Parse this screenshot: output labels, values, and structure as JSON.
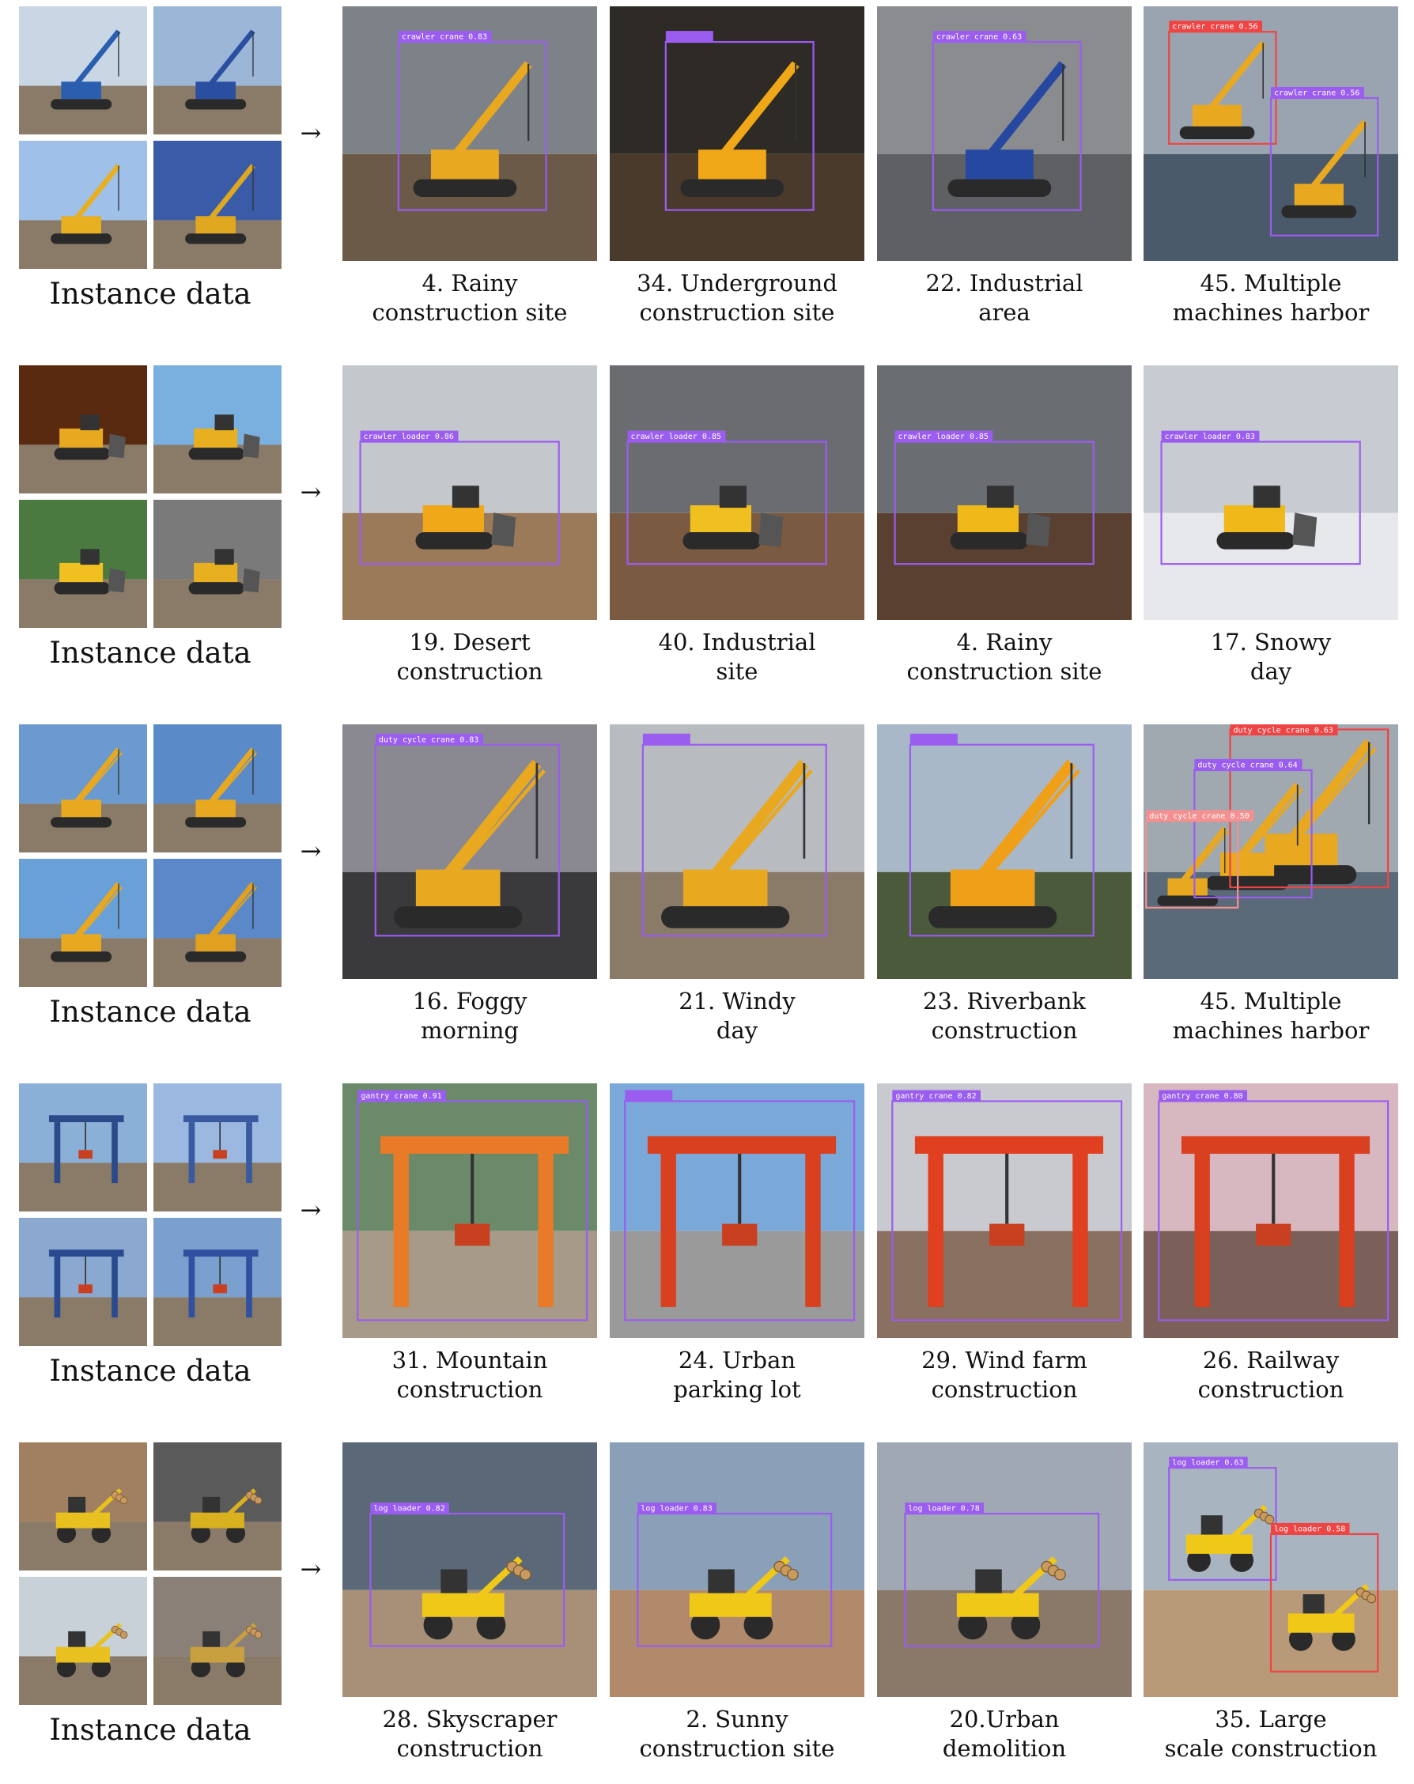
{
  "rows": [
    {
      "instance_caption": "Instance data",
      "arrow": "→",
      "machine": "crawler-crane",
      "instance_colors": [
        "#2a5fb0",
        "#2a4fa0",
        "#e8b020",
        "#e0a820"
      ],
      "instance_skies": [
        "#c9d6e4",
        "#9cb6d8",
        "#9fc0e8",
        "#3a5ca8"
      ],
      "scenes": [
        {
          "line1": "4.  Rainy",
          "line2": "construction site",
          "sky": "#7d8288",
          "ground": "#6b5a48",
          "machine_color": "#e8a820",
          "detections": [
            {
              "label": "crawler crane 0.83",
              "color": "#9b5cf0"
            }
          ]
        },
        {
          "line1": "34.  Underground",
          "line2": "construction site",
          "sky": "#2e2a26",
          "ground": "#4a3a2c",
          "machine_color": "#f0a818",
          "detections": [
            {
              "label": "",
              "color": "#9b5cf0"
            }
          ]
        },
        {
          "line1": "22.  Industrial",
          "line2": "area",
          "sky": "#8a8c90",
          "ground": "#5e6064",
          "machine_color": "#2648a0",
          "detections": [
            {
              "label": "crawler crane 0.63",
              "color": "#9b5cf0"
            }
          ]
        },
        {
          "line1": "45.  Multiple",
          "line2": "machines harbor",
          "sky": "#9aa4b0",
          "ground": "#4a5a6a",
          "machine_color": "#e8a820",
          "detections": [
            {
              "label": "crawler crane 0.56",
              "color": "#ef4444"
            },
            {
              "label": "crawler crane 0.56",
              "color": "#9b5cf0"
            }
          ]
        }
      ]
    },
    {
      "instance_caption": "Instance data",
      "arrow": "→",
      "machine": "crawler-loader",
      "instance_colors": [
        "#e8a820",
        "#e8b020",
        "#f0c020",
        "#e8b020"
      ],
      "instance_skies": [
        "#5a2a10",
        "#7ab0e0",
        "#4a7a40",
        "#7a7a7a"
      ],
      "scenes": [
        {
          "line1": "19.  Desert",
          "line2": "construction",
          "sky": "#c4c8cc",
          "ground": "#9a7a58",
          "machine_color": "#f0a818",
          "detections": [
            {
              "label": "crawler loader 0.86",
              "color": "#9b5cf0"
            }
          ]
        },
        {
          "line1": "40.  Industrial",
          "line2": "site",
          "sky": "#6a6c70",
          "ground": "#7a5a40",
          "machine_color": "#f0c020",
          "detections": [
            {
              "label": "crawler loader 0.85",
              "color": "#9b5cf0"
            }
          ]
        },
        {
          "line1": "4.  Rainy",
          "line2": "construction site",
          "sky": "#6a6e72",
          "ground": "#5a4030",
          "machine_color": "#f0b818",
          "detections": [
            {
              "label": "crawler loader 0.85",
              "color": "#9b5cf0"
            }
          ]
        },
        {
          "line1": "17.  Snowy",
          "line2": "day",
          "sky": "#c8ccd2",
          "ground": "#e6e8ec",
          "machine_color": "#f0b818",
          "detections": [
            {
              "label": "crawler loader 0.83",
              "color": "#9b5cf0"
            }
          ]
        }
      ]
    },
    {
      "instance_caption": "Instance data",
      "arrow": "→",
      "machine": "duty-cycle-crane",
      "instance_colors": [
        "#e8a820",
        "#e8a820",
        "#e8a820",
        "#e0a020"
      ],
      "instance_skies": [
        "#6a9ad0",
        "#5a8ac8",
        "#6aa0d8",
        "#5a88c8"
      ],
      "scenes": [
        {
          "line1": "16.  Foggy",
          "line2": "morning",
          "sky": "#8a8890",
          "ground": "#3a3a3c",
          "machine_color": "#e8a820",
          "detections": [
            {
              "label": "duty cycle crane 0.83",
              "color": "#9b5cf0"
            }
          ]
        },
        {
          "line1": "21.  Windy",
          "line2": "day",
          "sky": "#b8bcc0",
          "ground": "#8a7a68",
          "machine_color": "#e8a820",
          "detections": [
            {
              "label": "",
              "color": "#9b5cf0"
            }
          ]
        },
        {
          "line1": "23.  Riverbank",
          "line2": "construction",
          "sky": "#a8b8c8",
          "ground": "#4a5a3a",
          "machine_color": "#f0a018",
          "detections": [
            {
              "label": "",
              "color": "#9b5cf0"
            }
          ]
        },
        {
          "line1": "45.  Multiple",
          "line2": "machines harbor",
          "sky": "#a0a8b0",
          "ground": "#5a6a78",
          "machine_color": "#e8a820",
          "detections": [
            {
              "label": "duty cycle crane 0.63",
              "color": "#ef4444"
            },
            {
              "label": "duty cycle crane 0.64",
              "color": "#9b5cf0"
            },
            {
              "label": "duty cycle crane 0.50",
              "color": "#f49090"
            }
          ]
        }
      ]
    },
    {
      "instance_caption": "Instance data",
      "arrow": "→",
      "machine": "gantry-crane",
      "instance_colors": [
        "#2a4a8a",
        "#3a5aa0",
        "#2a4a90",
        "#3050a0"
      ],
      "instance_skies": [
        "#8ab0d8",
        "#9ab8e0",
        "#8aa8d0",
        "#7aa0d0"
      ],
      "scenes": [
        {
          "line1": "31.  Mountain",
          "line2": "construction",
          "sky": "#6a8a6a",
          "ground": "#a89a88",
          "machine_color": "#e87a28",
          "detections": [
            {
              "label": "gantry crane 0.91",
              "color": "#9b5cf0"
            }
          ]
        },
        {
          "line1": "24.  Urban",
          "line2": "parking lot",
          "sky": "#7aa8d8",
          "ground": "#9a9a9a",
          "machine_color": "#d84020",
          "detections": [
            {
              "label": "",
              "color": "#9b5cf0"
            }
          ]
        },
        {
          "line1": "29.  Wind farm",
          "line2": "construction",
          "sky": "#c8cad0",
          "ground": "#8a7060",
          "machine_color": "#e04020",
          "detections": [
            {
              "label": "gantry crane 0.82",
              "color": "#9b5cf0"
            }
          ]
        },
        {
          "line1": "26.  Railway",
          "line2": "construction",
          "sky": "#d8b8c0",
          "ground": "#7a6058",
          "machine_color": "#d84020",
          "detections": [
            {
              "label": "gantry crane 0.80",
              "color": "#9b5cf0"
            }
          ]
        }
      ]
    },
    {
      "instance_caption": "Instance data",
      "arrow": "→",
      "machine": "log-loader",
      "instance_colors": [
        "#e8c020",
        "#d8b020",
        "#e8c020",
        "#c8a040"
      ],
      "instance_skies": [
        "#a08060",
        "#5a5a5a",
        "#c8d0d8",
        "#8a8078"
      ],
      "scenes": [
        {
          "line1": "28.  Skyscraper",
          "line2": "construction",
          "sky": "#5a6878",
          "ground": "#a89078",
          "machine_color": "#f0c818",
          "detections": [
            {
              "label": "log loader 0.82",
              "color": "#9b5cf0"
            }
          ]
        },
        {
          "line1": "2.  Sunny",
          "line2": "construction site",
          "sky": "#8aa0b8",
          "ground": "#b08a6a",
          "machine_color": "#f0c818",
          "detections": [
            {
              "label": "log loader 0.83",
              "color": "#9b5cf0"
            }
          ]
        },
        {
          "line1": "20.Urban",
          "line2": "demolition",
          "sky": "#a0a8b4",
          "ground": "#8a7868",
          "machine_color": "#f0c818",
          "detections": [
            {
              "label": "log loader 0.78",
              "color": "#9b5cf0"
            }
          ]
        },
        {
          "line1": "35.  Large",
          "line2": "scale construction",
          "sky": "#a8b4c0",
          "ground": "#b89a78",
          "machine_color": "#f0c818",
          "detections": [
            {
              "label": "log loader 0.63",
              "color": "#9b5cf0"
            },
            {
              "label": "log loader 0.58",
              "color": "#ef4444"
            }
          ]
        }
      ]
    }
  ]
}
